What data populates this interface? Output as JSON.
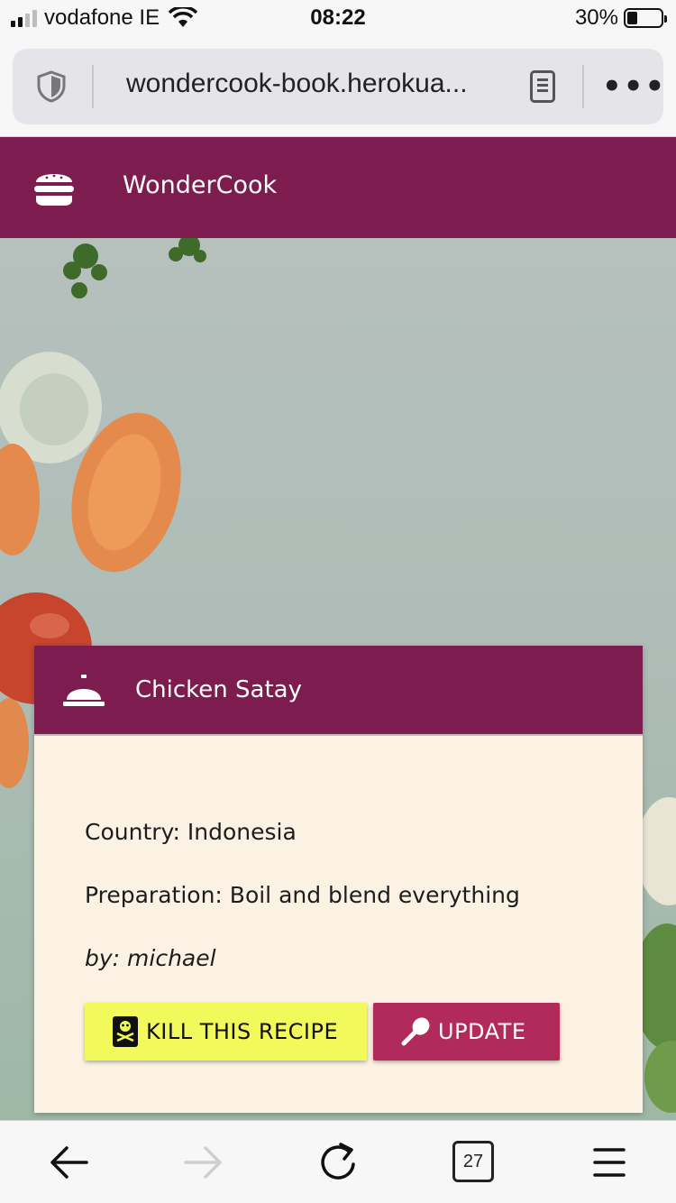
{
  "status_bar": {
    "carrier": "vodafone IE",
    "time": "08:22",
    "battery_percent": "30%",
    "battery_level": 0.3,
    "signal_bars": 2
  },
  "browser": {
    "url": "wondercook-book.herokua...",
    "tab_count": "27",
    "icons": [
      "shield-icon",
      "reader-mode-icon",
      "more-icon",
      "back-arrow-icon",
      "forward-arrow-icon",
      "reload-icon",
      "menu-icon"
    ]
  },
  "site": {
    "brand": "WonderCook",
    "brand_color": "#7d1c4e"
  },
  "recipe": {
    "title": "Chicken Satay",
    "country": "Country: Indonesia",
    "preparation": "Preparation: Boil and blend everything",
    "author": "by: michael",
    "kill_label": "KILL THIS RECIPE",
    "update_label": "UPDATE"
  },
  "colors": {
    "kill_button": "#f1fa5a",
    "update_button": "#b12a5a",
    "card_background": "#fbf2e3"
  }
}
